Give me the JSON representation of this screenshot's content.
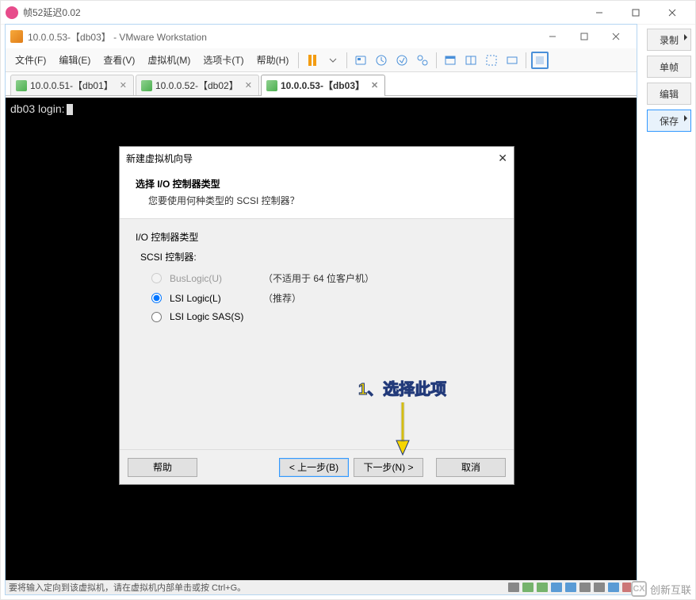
{
  "outer": {
    "title": "帧52延迟0.02"
  },
  "sidebar": {
    "record": "录制",
    "single": "单帧",
    "edit": "编辑",
    "save": "保存"
  },
  "vmware": {
    "title": "10.0.0.53-【db03】 - VMware Workstation",
    "menu": {
      "file": "文件(F)",
      "edit": "编辑(E)",
      "view": "查看(V)",
      "vm": "虚拟机(M)",
      "tabs": "选项卡(T)",
      "help": "帮助(H)"
    },
    "tabs": [
      {
        "label": "10.0.0.51-【db01】"
      },
      {
        "label": "10.0.0.52-【db02】"
      },
      {
        "label": "10.0.0.53-【db03】"
      }
    ],
    "console_line": "db03 login:",
    "status_text": "要将输入定向到该虚拟机，请在虚拟机内部单击或按 Ctrl+G。"
  },
  "wizard": {
    "window_title": "新建虚拟机向导",
    "heading": "选择 I/O 控制器类型",
    "subheading": "您要使用何种类型的 SCSI 控制器？",
    "group_label": "I/O 控制器类型",
    "sub_label": "SCSI 控制器:",
    "options": {
      "buslogic": "BusLogic(U)",
      "buslogic_note": "（不适用于 64 位客户机）",
      "lsi": "LSI Logic(L)",
      "lsi_note": "（推荐）",
      "lsi_sas": "LSI Logic SAS(S)"
    },
    "buttons": {
      "help": "帮助",
      "back": "< 上一步(B)",
      "next": "下一步(N) >",
      "cancel": "取消"
    }
  },
  "annotation": {
    "text": "1、选择此项"
  },
  "watermark": "创新互联"
}
